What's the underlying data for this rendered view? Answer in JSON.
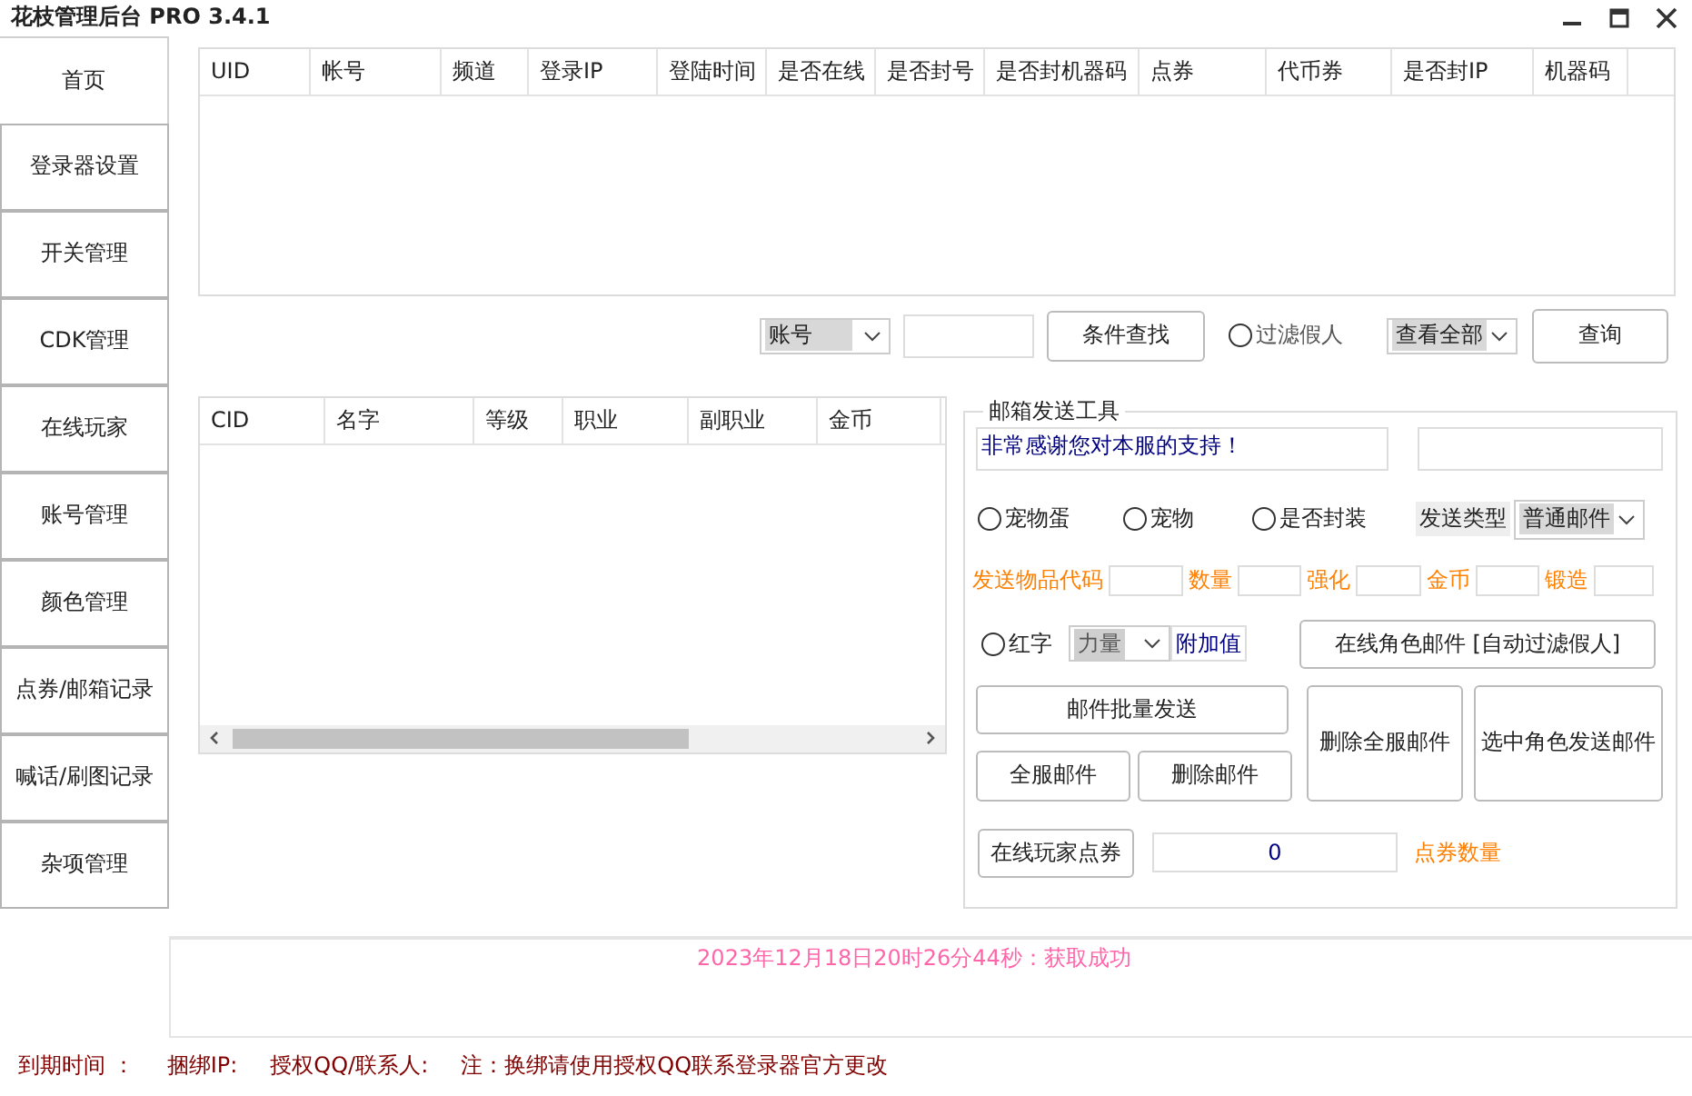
{
  "window": {
    "title": "花枝管理后台 PRO 3.4.1"
  },
  "sidebar": {
    "items": [
      {
        "label": "首页",
        "selected": true
      },
      {
        "label": "登录器设置",
        "selected": false
      },
      {
        "label": "开关管理",
        "selected": false
      },
      {
        "label": "CDK管理",
        "selected": false
      },
      {
        "label": "在线玩家",
        "selected": false
      },
      {
        "label": "账号管理",
        "selected": false
      },
      {
        "label": "颜色管理",
        "selected": false
      },
      {
        "label": "点券/邮箱记录",
        "selected": false
      },
      {
        "label": "喊话/刷图记录",
        "selected": false
      },
      {
        "label": "杂项管理",
        "selected": false
      }
    ]
  },
  "account_table": {
    "columns": [
      "UID",
      "帐号",
      "频道",
      "登录IP",
      "登陆时间",
      "是否在线",
      "是否封号",
      "是否封机器码",
      "点券",
      "代币券",
      "是否封IP",
      "机器码"
    ]
  },
  "search_bar": {
    "field_select": "账号",
    "find_button": "条件查找",
    "filter_fake": {
      "label": "过滤假人",
      "checked": false
    },
    "view_select": "查看全部",
    "query_button": "查询"
  },
  "character_table": {
    "columns": [
      "CID",
      "名字",
      "等级",
      "职业",
      "副职业",
      "金币"
    ]
  },
  "mail_tool": {
    "title": "邮箱发送工具",
    "message": "非常感谢您对本服的支持！",
    "options": [
      {
        "label": "宠物蛋",
        "checked": false
      },
      {
        "label": "宠物",
        "checked": false
      },
      {
        "label": "是否封装",
        "checked": false
      }
    ],
    "send_type_label": "发送类型",
    "send_type": "普通邮件",
    "item_fields": [
      "发送物品代码",
      "数量",
      "强化",
      "金币",
      "锻造"
    ],
    "red_text": {
      "label": "红字",
      "checked": false
    },
    "attribute": "力量",
    "bonus_label": "附加值",
    "online_mail_button": "在线角色邮件 [自动过滤假人]",
    "batch_button": "邮件批量发送",
    "server_mail_button": "全服邮件",
    "delete_mail_button": "删除邮件",
    "delete_server_mail_button": "删除全服邮件",
    "selected_role_button": "选中角色发送邮件",
    "points_button": "在线玩家点券",
    "points_value": "0",
    "points_label": "点券数量"
  },
  "status_message": "2023年12月18日20时26分44秒：获取成功",
  "footer": [
    "到期时间 ：",
    "捆绑IP:",
    "授权QQ/联系人:",
    "注：换绑请使用授权QQ联系登录器官方更改"
  ]
}
